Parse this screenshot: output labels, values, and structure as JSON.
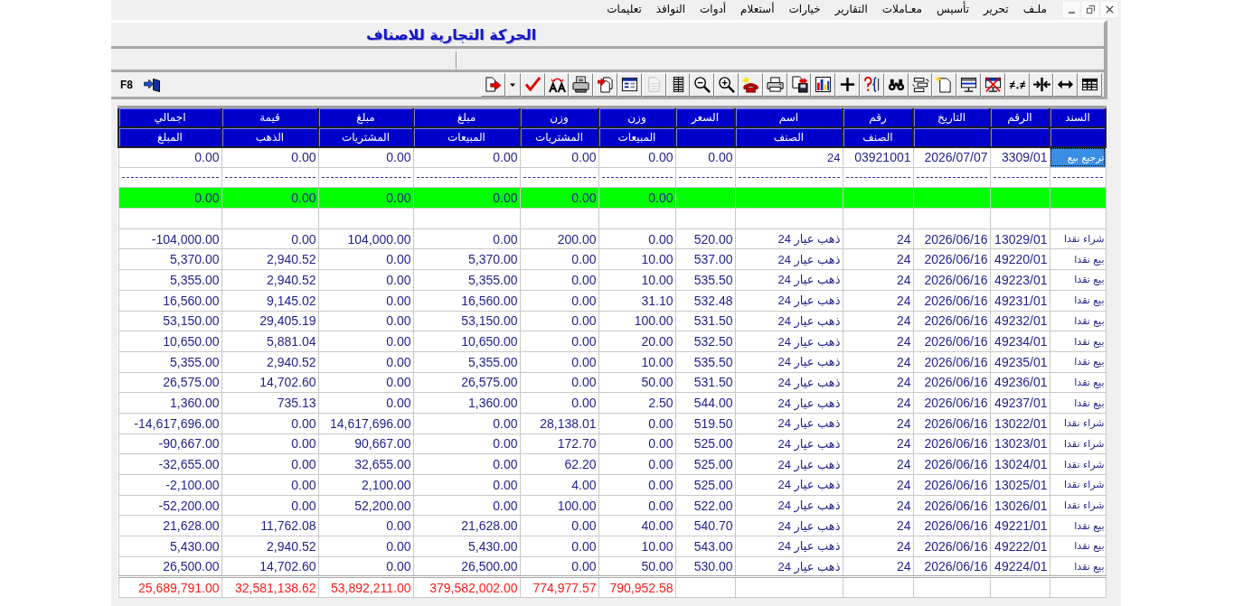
{
  "menu_bar": {
    "items": [
      "ملـف",
      "تحرير",
      "تأسيس",
      "معـاملات",
      "التقارير",
      "خيارات",
      "أستعلام",
      "أدوات",
      "النوافذ",
      "تعليمات"
    ]
  },
  "window": {
    "title": "الحركة التجارية للاصناف"
  },
  "toolbar": {
    "shortcut": "F8",
    "buttons": [
      {
        "disabled": false
      },
      {
        "disabled": false
      },
      {
        "disabled": false
      },
      {
        "disabled": false
      },
      {
        "disabled": false
      },
      {
        "disabled": false
      },
      {
        "disabled": false
      },
      {
        "disabled": true
      },
      {
        "disabled": false
      },
      {
        "disabled": false
      },
      {
        "disabled": false
      },
      {
        "disabled": false
      },
      {
        "disabled": false
      },
      {
        "disabled": false
      },
      {
        "disabled": false
      },
      {
        "disabled": false
      },
      {
        "disabled": false
      },
      {
        "disabled": false
      },
      {
        "disabled": false
      },
      {
        "disabled": false
      },
      {
        "disabled": false
      },
      {
        "disabled": false
      },
      {
        "disabled": false
      },
      {
        "disabled": false
      },
      {
        "disabled": false
      },
      {
        "disabled": false
      }
    ]
  },
  "table": {
    "columns": [
      {
        "title": "السند"
      },
      {
        "title": "الرقم"
      },
      {
        "title": "التاريخ"
      },
      {
        "title": "رقم",
        "subtitle": "الصنف"
      },
      {
        "title": "اسم",
        "subtitle": "الصنف"
      },
      {
        "title": "السعر"
      },
      {
        "title": "وزن",
        "subtitle": "المبيعات"
      },
      {
        "title": "وزن",
        "subtitle": "المشتريات"
      },
      {
        "title": "مبلغ",
        "subtitle": "المبيعات"
      },
      {
        "title": "مبلغ",
        "subtitle": "المشتريات"
      },
      {
        "title": "قيمة",
        "subtitle": "الذهب"
      },
      {
        "title": "اجمالي",
        "subtitle": "المبلغ"
      }
    ],
    "rows": [
      {
        "kind": "data",
        "selected": true,
        "cells": [
          "0.00",
          "0.00",
          "0.00",
          "0.00",
          "0.00",
          "0.00",
          "0.00",
          "24",
          "03921001",
          "2026/07/07",
          "3309/01",
          "ترجيع بيع"
        ]
      },
      {
        "kind": "separator"
      },
      {
        "kind": "subtotal",
        "cells": [
          "0.00",
          "0.00",
          "0.00",
          "0.00",
          "0.00",
          "0.00"
        ]
      },
      {
        "kind": "blank"
      },
      {
        "kind": "data",
        "selected": false,
        "cells": [
          "-104,000.00",
          "0.00",
          "104,000.00",
          "0.00",
          "200.00",
          "0.00",
          "520.00",
          "ذهب عيار 24",
          "24",
          "2026/06/16",
          "13029/01",
          "شراء نقدا"
        ]
      },
      {
        "kind": "data",
        "selected": false,
        "cells": [
          "5,370.00",
          "2,940.52",
          "0.00",
          "5,370.00",
          "0.00",
          "10.00",
          "537.00",
          "ذهب عيار 24",
          "24",
          "2026/06/16",
          "49220/01",
          "بيع نقدا"
        ]
      },
      {
        "kind": "data",
        "selected": false,
        "cells": [
          "5,355.00",
          "2,940.52",
          "0.00",
          "5,355.00",
          "0.00",
          "10.00",
          "535.50",
          "ذهب عيار 24",
          "24",
          "2026/06/16",
          "49223/01",
          "بيع نقدا"
        ]
      },
      {
        "kind": "data",
        "selected": false,
        "cells": [
          "16,560.00",
          "9,145.02",
          "0.00",
          "16,560.00",
          "0.00",
          "31.10",
          "532.48",
          "ذهب عيار 24",
          "24",
          "2026/06/16",
          "49231/01",
          "بيع نقدا"
        ]
      },
      {
        "kind": "data",
        "selected": false,
        "cells": [
          "53,150.00",
          "29,405.19",
          "0.00",
          "53,150.00",
          "0.00",
          "100.00",
          "531.50",
          "ذهب عيار 24",
          "24",
          "2026/06/16",
          "49232/01",
          "بيع نقدا"
        ]
      },
      {
        "kind": "data",
        "selected": false,
        "cells": [
          "10,650.00",
          "5,881.04",
          "0.00",
          "10,650.00",
          "0.00",
          "20.00",
          "532.50",
          "ذهب عيار 24",
          "24",
          "2026/06/16",
          "49234/01",
          "بيع نقدا"
        ]
      },
      {
        "kind": "data",
        "selected": false,
        "cells": [
          "5,355.00",
          "2,940.52",
          "0.00",
          "5,355.00",
          "0.00",
          "10.00",
          "535.50",
          "ذهب عيار 24",
          "24",
          "2026/06/16",
          "49235/01",
          "بيع نقدا"
        ]
      },
      {
        "kind": "data",
        "selected": false,
        "cells": [
          "26,575.00",
          "14,702.60",
          "0.00",
          "26,575.00",
          "0.00",
          "50.00",
          "531.50",
          "ذهب عيار 24",
          "24",
          "2026/06/16",
          "49236/01",
          "بيع نقدا"
        ]
      },
      {
        "kind": "data",
        "selected": false,
        "cells": [
          "1,360.00",
          "735.13",
          "0.00",
          "1,360.00",
          "0.00",
          "2.50",
          "544.00",
          "ذهب عيار 24",
          "24",
          "2026/06/16",
          "49237/01",
          "بيع نقدا"
        ]
      },
      {
        "kind": "data",
        "selected": false,
        "cells": [
          "-14,617,696.00",
          "0.00",
          "14,617,696.00",
          "0.00",
          "28,138.01",
          "0.00",
          "519.50",
          "ذهب عيار 24",
          "24",
          "2026/06/16",
          "13022/01",
          "شراء نقدا"
        ]
      },
      {
        "kind": "data",
        "selected": false,
        "cells": [
          "-90,667.00",
          "0.00",
          "90,667.00",
          "0.00",
          "172.70",
          "0.00",
          "525.00",
          "ذهب عيار 24",
          "24",
          "2026/06/16",
          "13023/01",
          "شراء نقدا"
        ]
      },
      {
        "kind": "data",
        "selected": false,
        "cells": [
          "-32,655.00",
          "0.00",
          "32,655.00",
          "0.00",
          "62.20",
          "0.00",
          "525.00",
          "ذهب عيار 24",
          "24",
          "2026/06/16",
          "13024/01",
          "شراء نقدا"
        ]
      },
      {
        "kind": "data",
        "selected": false,
        "cells": [
          "-2,100.00",
          "0.00",
          "2,100.00",
          "0.00",
          "4.00",
          "0.00",
          "525.00",
          "ذهب عيار 24",
          "24",
          "2026/06/16",
          "13025/01",
          "شراء نقدا"
        ]
      },
      {
        "kind": "data",
        "selected": false,
        "cells": [
          "-52,200.00",
          "0.00",
          "52,200.00",
          "0.00",
          "100.00",
          "0.00",
          "522.00",
          "ذهب عيار 24",
          "24",
          "2026/06/16",
          "13026/01",
          "شراء نقدا"
        ]
      },
      {
        "kind": "data",
        "selected": false,
        "cells": [
          "21,628.00",
          "11,762.08",
          "0.00",
          "21,628.00",
          "0.00",
          "40.00",
          "540.70",
          "ذهب عيار 24",
          "24",
          "2026/06/16",
          "49221/01",
          "بيع نقدا"
        ]
      },
      {
        "kind": "data",
        "selected": false,
        "cells": [
          "5,430.00",
          "2,940.52",
          "0.00",
          "5,430.00",
          "0.00",
          "10.00",
          "543.00",
          "ذهب عيار 24",
          "24",
          "2026/06/16",
          "49222/01",
          "بيع نقدا"
        ]
      },
      {
        "kind": "data",
        "selected": false,
        "cells": [
          "26,500.00",
          "14,702.60",
          "0.00",
          "26,500.00",
          "0.00",
          "50.00",
          "530.00",
          "ذهب عيار 24",
          "24",
          "2026/06/16",
          "49224/01",
          "بيع نقدا"
        ]
      },
      {
        "kind": "total",
        "cells": [
          "25,689,791.00",
          "32,581,138.62",
          "53,892,211.00",
          "379,582,002.00",
          "774,977.57",
          "790,952.58"
        ]
      }
    ]
  }
}
